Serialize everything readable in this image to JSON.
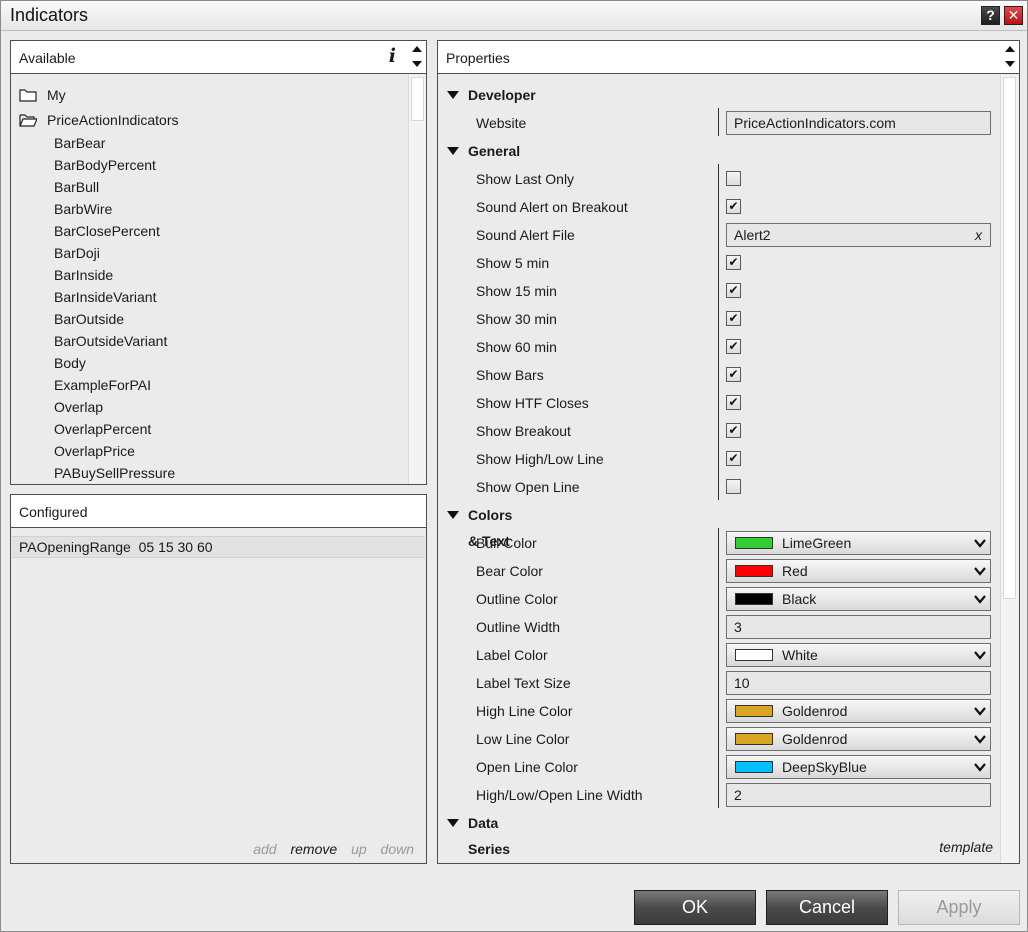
{
  "window": {
    "title": "Indicators"
  },
  "titlebar": {
    "help_glyph": "?",
    "close_glyph": "✕"
  },
  "available": {
    "header": "Available",
    "info_glyph": "i",
    "folders": [
      {
        "label": "My",
        "open": false
      },
      {
        "label": "PriceActionIndicators",
        "open": true
      }
    ],
    "items": [
      "BarBear",
      "BarBodyPercent",
      "BarBull",
      "BarbWire",
      "BarClosePercent",
      "BarDoji",
      "BarInside",
      "BarInsideVariant",
      "BarOutside",
      "BarOutsideVariant",
      "Body",
      "ExampleForPAI",
      "Overlap",
      "OverlapPercent",
      "OverlapPrice",
      "PABuySellPressure"
    ]
  },
  "configured": {
    "header": "Configured",
    "items": [
      "PAOpeningRange  05 15 30 60"
    ],
    "actions": {
      "add": "add",
      "remove": "remove",
      "up": "up",
      "down": "down"
    }
  },
  "properties": {
    "header": "Properties",
    "template_link": "template",
    "categories": {
      "developer": "Developer",
      "general": "General",
      "colors_text": "Colors & Text",
      "data_series": "Data Series"
    },
    "developer": {
      "website_label": "Website",
      "website_value": "PriceActionIndicators.com"
    },
    "general": {
      "show_last_only": {
        "label": "Show Last Only",
        "checked": false
      },
      "sound_alert_breakout": {
        "label": "Sound Alert on Breakout",
        "checked": true
      },
      "sound_alert_file": {
        "label": "Sound Alert File",
        "value": "Alert2",
        "clear": "x"
      },
      "show_5": {
        "label": "Show 5 min",
        "checked": true
      },
      "show_15": {
        "label": "Show 15 min",
        "checked": true
      },
      "show_30": {
        "label": "Show 30 min",
        "checked": true
      },
      "show_60": {
        "label": "Show 60 min",
        "checked": true
      },
      "show_bars": {
        "label": "Show Bars",
        "checked": true
      },
      "show_htf": {
        "label": "Show HTF Closes",
        "checked": true
      },
      "show_breakout": {
        "label": "Show Breakout",
        "checked": true
      },
      "show_highlow": {
        "label": "Show High/Low Line",
        "checked": true
      },
      "show_open": {
        "label": "Show Open Line",
        "checked": false
      }
    },
    "colors": {
      "bull": {
        "label": "Bull Color",
        "name": "LimeGreen",
        "hex": "#32cd32"
      },
      "bear": {
        "label": "Bear Color",
        "name": "Red",
        "hex": "#ff0000"
      },
      "outline": {
        "label": "Outline Color",
        "name": "Black",
        "hex": "#000000"
      },
      "outline_width": {
        "label": "Outline Width",
        "value": "3"
      },
      "label_color": {
        "label": "Label Color",
        "name": "White",
        "hex": "#ffffff"
      },
      "label_text_size": {
        "label": "Label Text Size",
        "value": "10"
      },
      "high_line": {
        "label": "High Line Color",
        "name": "Goldenrod",
        "hex": "#daa520"
      },
      "low_line": {
        "label": "Low Line Color",
        "name": "Goldenrod",
        "hex": "#daa520"
      },
      "open_line": {
        "label": "Open Line Color",
        "name": "DeepSkyBlue",
        "hex": "#00bfff"
      },
      "line_width": {
        "label": "High/Low/Open Line Width",
        "value": "2"
      }
    }
  },
  "buttons": {
    "ok": "OK",
    "cancel": "Cancel",
    "apply": "Apply"
  },
  "icons": {
    "folder": "folder-icon",
    "folder_open": "folder-open-icon",
    "chevron": "chevron-down-icon",
    "collapse": "triangle-down-icon"
  }
}
